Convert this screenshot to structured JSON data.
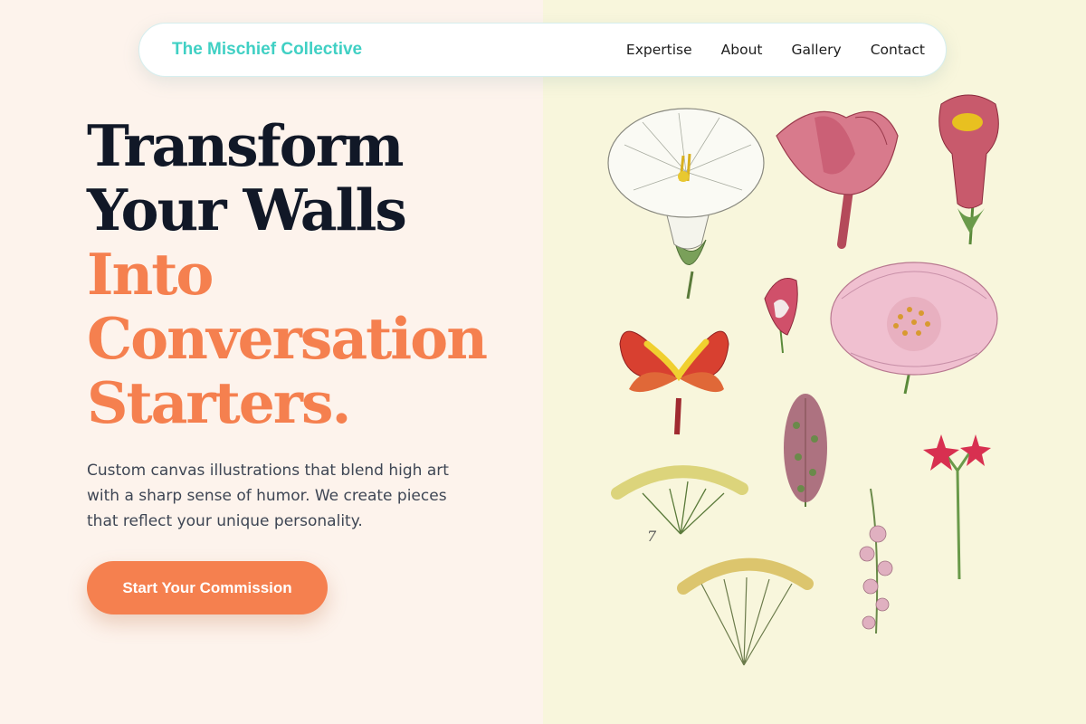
{
  "nav": {
    "brand": "The Mischief Collective",
    "links": [
      "Expertise",
      "About",
      "Gallery",
      "Contact"
    ]
  },
  "hero": {
    "title_dark": [
      "Transform",
      "Your Walls"
    ],
    "title_accent": [
      "Into",
      "Conversation",
      "Starters."
    ],
    "subtitle": "Custom canvas illustrations that blend high art with a sharp sense of humor. We create pieces that reflect your unique personality.",
    "cta_label": "Start Your Commission"
  },
  "illustration": {
    "plate_number": "7"
  },
  "colors": {
    "accent": "#f5804f",
    "brand": "#40d0c4",
    "heading": "#111827",
    "left_bg": "#fdf3ec",
    "right_bg": "#f8f6dc"
  }
}
